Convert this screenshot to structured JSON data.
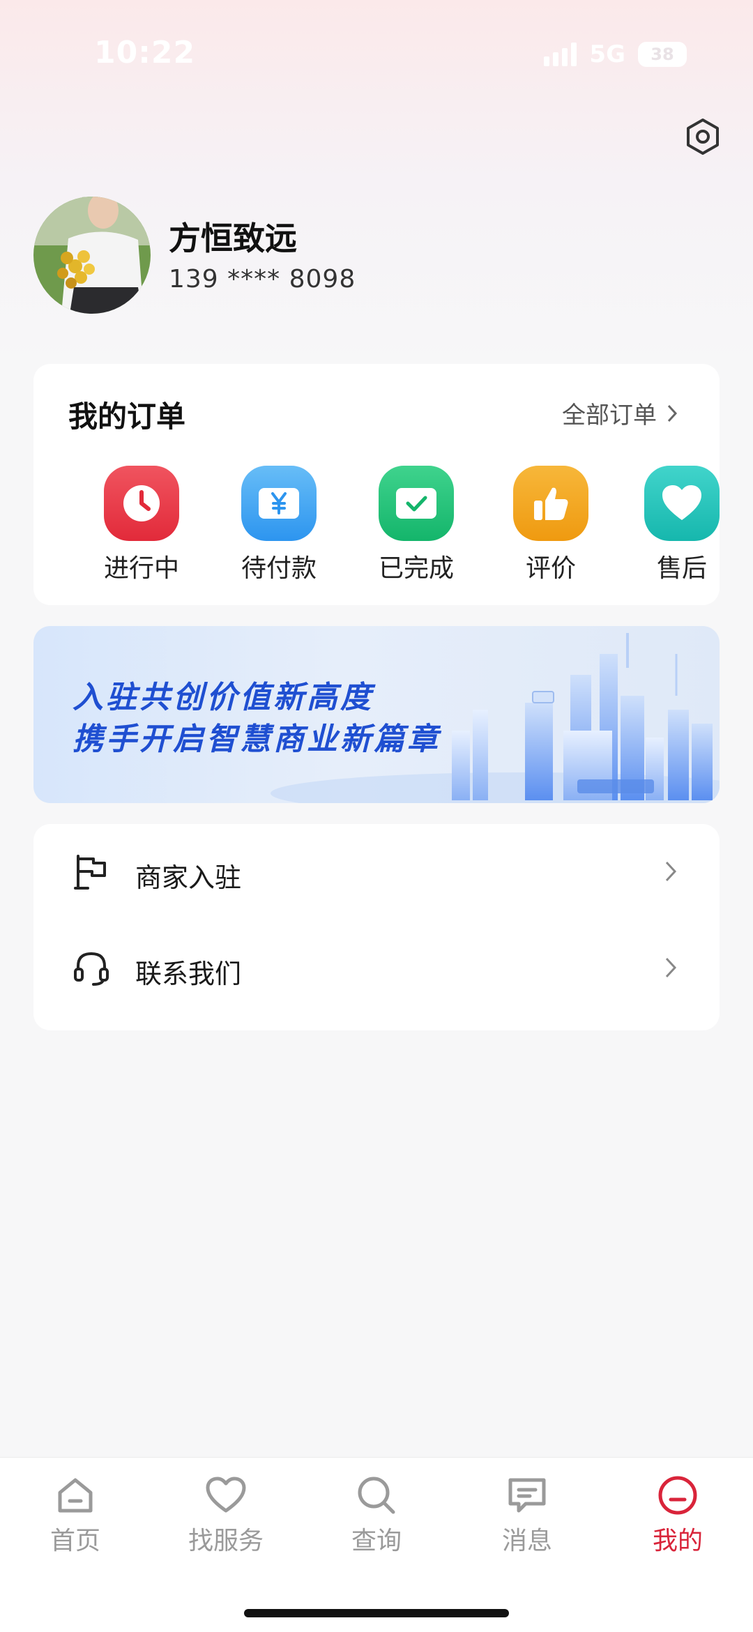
{
  "status": {
    "time": "10:22",
    "network": "5G",
    "battery": "38"
  },
  "profile": {
    "name": "方恒致远",
    "phone": "139 **** 8098"
  },
  "orders": {
    "title": "我的订单",
    "all_label": "全部订单",
    "items": [
      {
        "label": "进行中",
        "icon": "clock-icon",
        "color": "#e8303f"
      },
      {
        "label": "待付款",
        "icon": "yen-icon",
        "color": "#3aa0f2"
      },
      {
        "label": "已完成",
        "icon": "check-icon",
        "color": "#1fc27a"
      },
      {
        "label": "评价",
        "icon": "thumb-up-icon",
        "color": "#f3a41c"
      },
      {
        "label": "售后",
        "icon": "heart-icon",
        "color": "#27c6bd"
      }
    ]
  },
  "banner": {
    "line1": "入驻共创价值新高度",
    "line2": "携手开启智慧商业新篇章"
  },
  "menu": [
    {
      "label": "商家入驻",
      "icon": "flag-icon"
    },
    {
      "label": "联系我们",
      "icon": "headset-icon"
    }
  ],
  "tabs": [
    {
      "label": "首页",
      "icon": "home-icon"
    },
    {
      "label": "找服务",
      "icon": "heart-outline-icon"
    },
    {
      "label": "查询",
      "icon": "search-icon"
    },
    {
      "label": "消息",
      "icon": "message-icon"
    },
    {
      "label": "我的",
      "icon": "profile-icon",
      "active": true
    }
  ],
  "colors": {
    "accent": "#d9243a",
    "banner_text": "#1f4fd1"
  }
}
